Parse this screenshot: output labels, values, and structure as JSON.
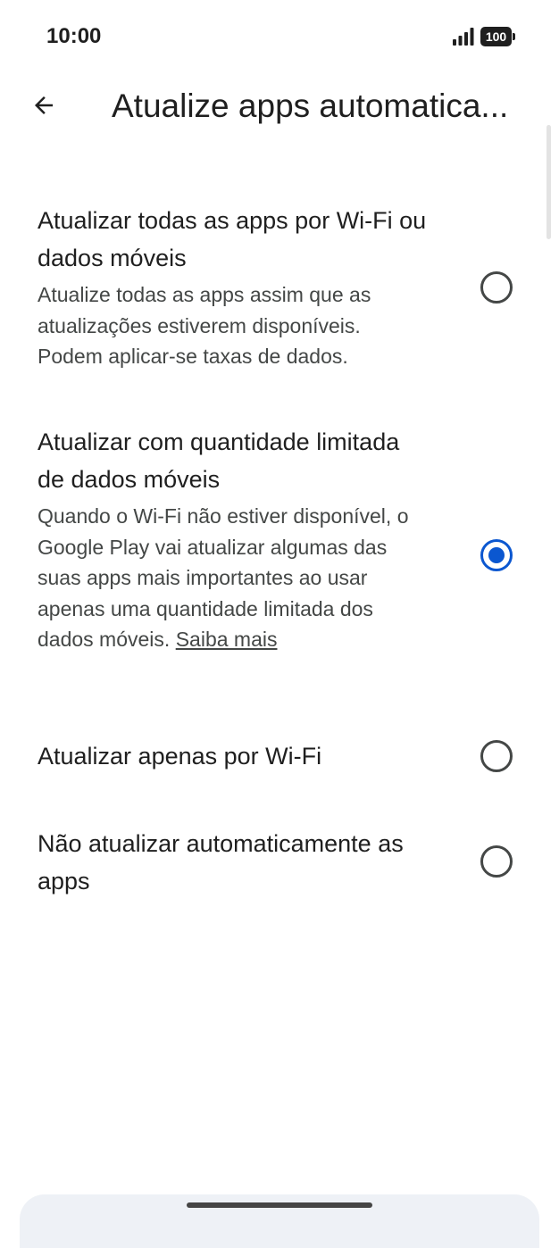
{
  "status_bar": {
    "time": "10:00",
    "battery": "100",
    "signal_icon": "signal-bars-icon",
    "battery_icon": "battery-icon"
  },
  "app_bar": {
    "back_icon": "arrow-back-icon",
    "title": "Atualize apps automatica..."
  },
  "options": [
    {
      "title": "Atualizar todas as apps por Wi-Fi ou dados móveis",
      "description": "Atualize todas as apps assim que as atualizações estiverem disponíveis. Podem aplicar-se taxas de dados.",
      "selected": false
    },
    {
      "title": "Atualizar com quantidade limitada de dados móveis",
      "description": "Quando o Wi-Fi não estiver disponível, o Google Play vai atualizar algumas das suas apps mais importantes ao usar apenas uma quantidade limitada dos dados móveis.",
      "link": "Saiba mais",
      "selected": true
    },
    {
      "title": "Atualizar apenas por Wi-Fi",
      "selected": false
    },
    {
      "title": "Não atualizar automaticamente as apps",
      "selected": false
    }
  ],
  "colors": {
    "accent": "#0b57d0",
    "text_primary": "#1f1f1f",
    "text_secondary": "#444746"
  }
}
